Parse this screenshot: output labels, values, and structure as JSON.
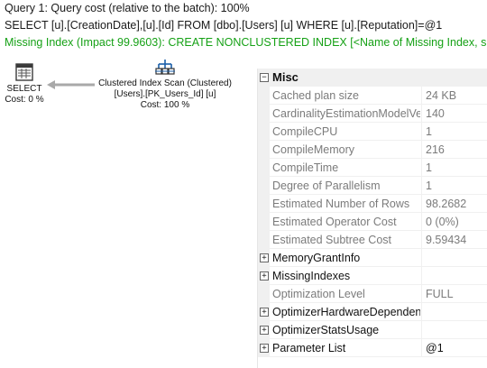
{
  "header": {
    "query_cost": "Query 1: Query cost (relative to the batch): 100%",
    "sql": "SELECT [u].[CreationDate],[u].[Id] FROM [dbo].[Users] [u] WHERE [u].[Reputation]=@1",
    "missing_index": "Missing Index (Impact 99.9603): CREATE NONCLUSTERED INDEX [<Name of Missing Index, s"
  },
  "plan": {
    "select_node": {
      "label": "SELECT",
      "cost": "Cost: 0 %"
    },
    "scan_node": {
      "label": "Clustered Index Scan (Clustered)",
      "object": "[Users].[PK_Users_Id] [u]",
      "cost": "Cost: 100 %"
    }
  },
  "properties": {
    "category": "Misc",
    "rows": [
      {
        "name": "Cached plan size",
        "value": "24 KB"
      },
      {
        "name": "CardinalityEstimationModelVersion",
        "value": "140"
      },
      {
        "name": "CompileCPU",
        "value": "1"
      },
      {
        "name": "CompileMemory",
        "value": "216"
      },
      {
        "name": "CompileTime",
        "value": "1"
      },
      {
        "name": "Degree of Parallelism",
        "value": "1"
      },
      {
        "name": "Estimated Number of Rows",
        "value": "98.2682"
      },
      {
        "name": "Estimated Operator Cost",
        "value": "0 (0%)"
      },
      {
        "name": "Estimated Subtree Cost",
        "value": "9.59434"
      },
      {
        "name": "MemoryGrantInfo",
        "value": ""
      },
      {
        "name": "MissingIndexes",
        "value": ""
      },
      {
        "name": "Optimization Level",
        "value": "FULL"
      },
      {
        "name": "OptimizerHardwareDependentProperties",
        "value": ""
      },
      {
        "name": "OptimizerStatsUsage",
        "value": ""
      },
      {
        "name": "Parameter List",
        "value": "@1"
      }
    ],
    "expander_symbols": {
      "expanded": "⊟",
      "collapsed": "+",
      "minus": "−"
    }
  },
  "colors": {
    "missing_index_text": "#16a116",
    "grey_text": "#7b7b7b",
    "panel_gray": "#f0f0f0"
  }
}
